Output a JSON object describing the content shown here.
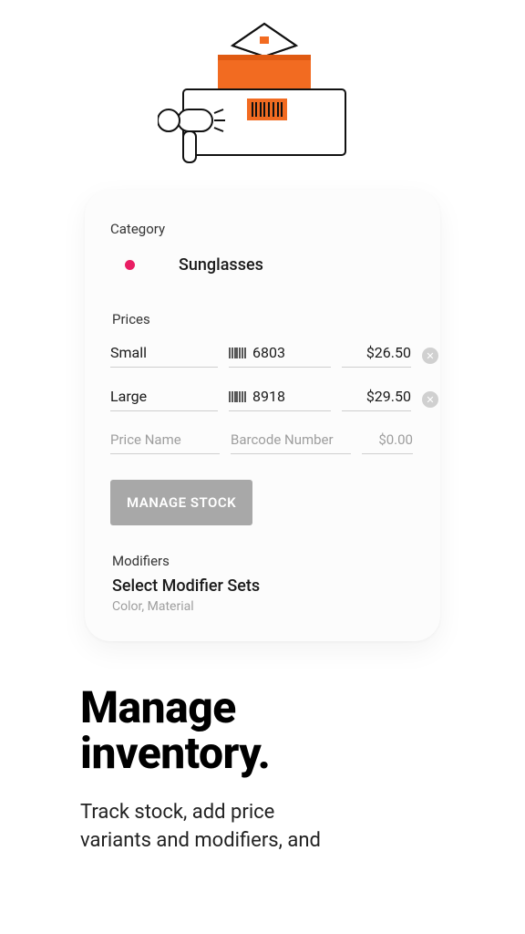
{
  "illustration": {
    "semantic": "stacked-packages-with-barcode-scanner"
  },
  "card": {
    "category_label": "Category",
    "category_name": "Sunglasses",
    "category_color": "#e91e63",
    "prices_label": "Prices",
    "prices": [
      {
        "name": "Small",
        "barcode": "6803",
        "price": "$26.50"
      },
      {
        "name": "Large",
        "barcode": "8918",
        "price": "$29.50"
      }
    ],
    "new_price": {
      "name_placeholder": "Price Name",
      "barcode_placeholder": "Barcode Number",
      "price_placeholder": "$0.00"
    },
    "manage_stock_label": "MANAGE STOCK",
    "modifiers_label": "Modifiers",
    "modifiers_title": "Select Modifier Sets",
    "modifiers_subtitle": "Color, Material"
  },
  "marketing": {
    "headline_line1": "Manage",
    "headline_line2": "inventory.",
    "subhead_line1": "Track stock, add price",
    "subhead_line2": "variants and modifiers, and"
  }
}
